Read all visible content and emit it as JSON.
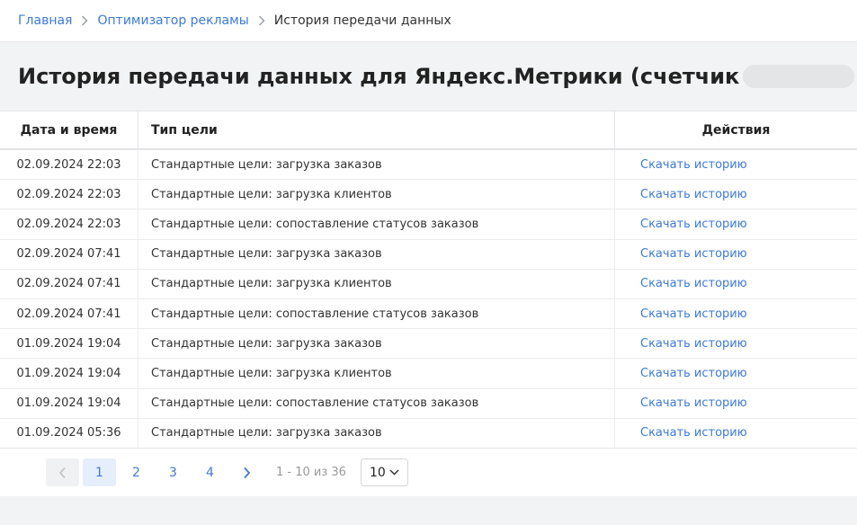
{
  "breadcrumbs": [
    {
      "label": "Главная"
    },
    {
      "label": "Оптимизатор рекламы"
    },
    {
      "label": "История передачи данных"
    }
  ],
  "page_title": {
    "prefix": "История передачи данных для Яндекс.Метрики (счетчик",
    "suffix": ")"
  },
  "table": {
    "headers": {
      "date": "Дата и время",
      "type": "Тип цели",
      "actions": "Действия"
    },
    "rows": [
      {
        "date": "02.09.2024 22:03",
        "type": "Стандартные цели: загрузка заказов",
        "action": "Скачать историю"
      },
      {
        "date": "02.09.2024 22:03",
        "type": "Стандартные цели: загрузка клиентов",
        "action": "Скачать историю"
      },
      {
        "date": "02.09.2024 22:03",
        "type": "Стандартные цели: сопоставление статусов заказов",
        "action": "Скачать историю"
      },
      {
        "date": "02.09.2024 07:41",
        "type": "Стандартные цели: загрузка заказов",
        "action": "Скачать историю"
      },
      {
        "date": "02.09.2024 07:41",
        "type": "Стандартные цели: загрузка клиентов",
        "action": "Скачать историю"
      },
      {
        "date": "02.09.2024 07:41",
        "type": "Стандартные цели: сопоставление статусов заказов",
        "action": "Скачать историю"
      },
      {
        "date": "01.09.2024 19:04",
        "type": "Стандартные цели: загрузка заказов",
        "action": "Скачать историю"
      },
      {
        "date": "01.09.2024 19:04",
        "type": "Стандартные цели: загрузка клиентов",
        "action": "Скачать историю"
      },
      {
        "date": "01.09.2024 19:04",
        "type": "Стандартные цели: сопоставление статусов заказов",
        "action": "Скачать историю"
      },
      {
        "date": "01.09.2024 05:36",
        "type": "Стандартные цели: загрузка заказов",
        "action": "Скачать историю"
      }
    ]
  },
  "pagination": {
    "pages": [
      "1",
      "2",
      "3",
      "4"
    ],
    "current": "1",
    "range": "1 - 10 из 36",
    "per_page": "10"
  },
  "colors": {
    "accent": "#3d7ad6",
    "background": "#f2f3f4"
  }
}
